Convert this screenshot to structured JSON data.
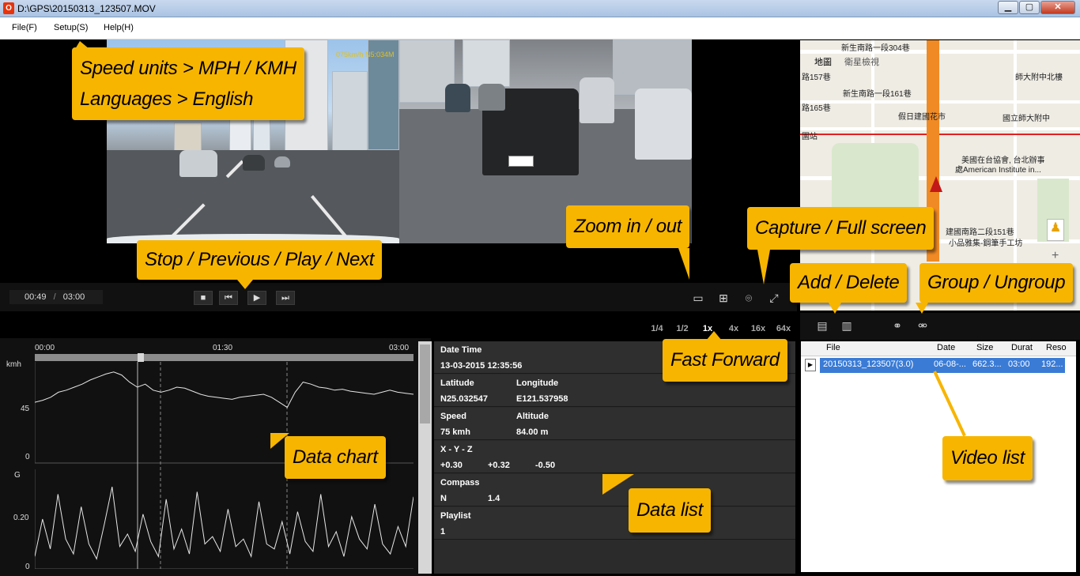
{
  "window": {
    "title": "D:\\GPS\\20150313_123507.MOV",
    "app_icon": "O",
    "min": "▁",
    "max": "▢",
    "close": "✕"
  },
  "menu": {
    "file": "File(F)",
    "setup": "Setup(S)",
    "help": "Help(H)"
  },
  "player": {
    "current_time": "00:49",
    "separator": "/",
    "duration": "03:00",
    "osd": "075km/h  N5:034M"
  },
  "controls": {
    "stop": "■",
    "previous": "⏮",
    "play": "▶",
    "next": "⏭",
    "zoom_out": "▭",
    "zoom_in": "⊞",
    "capture": "⌾",
    "fullscreen": "⤢"
  },
  "speeds": [
    "1/4",
    "1/2",
    "1x",
    "4x",
    "16x",
    "64x"
  ],
  "chart": {
    "time_ticks": [
      "00:00",
      "01:30",
      "03:00"
    ],
    "speed_unit": "kmh",
    "speed_ticks": [
      "45",
      "0"
    ],
    "g_unit": "G",
    "g_ticks": [
      "0.20",
      "0"
    ]
  },
  "chart_data": [
    {
      "type": "line",
      "ylabel": "kmh",
      "x_ticks": [
        "00:00",
        "01:30",
        "03:00"
      ],
      "y_ticks": [
        45,
        0
      ],
      "ylim": [
        0,
        100
      ],
      "series": [
        {
          "values": [
            60,
            62,
            65,
            70,
            72,
            75,
            78,
            82,
            85,
            88,
            90,
            87,
            80,
            75,
            78,
            72,
            70,
            72,
            75,
            74,
            71,
            68,
            66,
            65,
            64,
            63,
            65,
            66,
            67,
            68,
            65,
            60,
            55,
            70,
            80,
            78,
            75,
            74,
            72,
            73,
            71,
            70,
            69,
            68,
            70,
            72,
            70,
            69,
            68
          ]
        }
      ]
    },
    {
      "type": "line",
      "ylabel": "G",
      "y_ticks": [
        0.2,
        0
      ],
      "ylim": [
        0,
        0.4
      ],
      "series": [
        {
          "values": [
            0.05,
            0.2,
            0.08,
            0.3,
            0.12,
            0.06,
            0.25,
            0.1,
            0.04,
            0.18,
            0.33,
            0.09,
            0.14,
            0.07,
            0.22,
            0.11,
            0.05,
            0.28,
            0.08,
            0.16,
            0.06,
            0.31,
            0.1,
            0.13,
            0.07,
            0.24,
            0.09,
            0.12,
            0.05,
            0.27,
            0.1,
            0.08,
            0.19,
            0.06,
            0.23,
            0.11,
            0.07,
            0.3,
            0.09,
            0.15,
            0.05,
            0.21,
            0.12,
            0.08,
            0.26,
            0.1,
            0.06,
            0.17,
            0.09,
            0.29
          ]
        }
      ]
    }
  ],
  "data_list": {
    "date_time_label": "Date Time",
    "date_time": "13-03-2015 12:35:56",
    "latitude_label": "Latitude",
    "latitude": "N25.032547",
    "longitude_label": "Longitude",
    "longitude": "E121.537958",
    "speed_label": "Speed",
    "speed": "75 kmh",
    "altitude_label": "Altitude",
    "altitude": "84.00 m",
    "xyz_label": "X - Y - Z",
    "x": "+0.30",
    "y": "+0.32",
    "z": "-0.50",
    "compass_label": "Compass",
    "compass_dir": "N",
    "compass_val": "1.4",
    "playlist_label": "Playlist",
    "playlist": "1"
  },
  "map": {
    "tab_map": "地圖",
    "tab_sat": "衛星檢視",
    "labels": [
      "新生南路一段304巷",
      "師大附中北樓",
      "新生南路一段161巷",
      "假日建國花市",
      "國立師大附中",
      "美國在台協會, 台北辦事",
      "處American Institute in...",
      "建國南路二段151巷",
      "小品雅集-鋼筆手工坊",
      "路157巷",
      "路165巷",
      "園站"
    ]
  },
  "video_list": {
    "headers": [
      "File",
      "Date",
      "Size",
      "Durat",
      "Reso"
    ],
    "rows": [
      {
        "file": "20150313_123507(3.0)",
        "date": "06-08-...",
        "size": "662.3...",
        "duration": "03:00",
        "resolution": "192..."
      }
    ]
  },
  "callouts": {
    "setup_line1": "Speed units > MPH / KMH",
    "setup_line2": "Languages > English",
    "playback": "Stop / Previous / Play /  Next",
    "zoom": "Zoom in / out",
    "capture": "Capture /  Full screen",
    "add_delete": "Add / Delete",
    "group": "Group / Ungroup",
    "fast_forward": "Fast Forward",
    "data_chart": "Data chart",
    "data_list": "Data list",
    "video_list": "Video list"
  },
  "colors": {
    "callout": "#f7b500",
    "selection": "#3a7bd5",
    "route": "#f08a24"
  }
}
